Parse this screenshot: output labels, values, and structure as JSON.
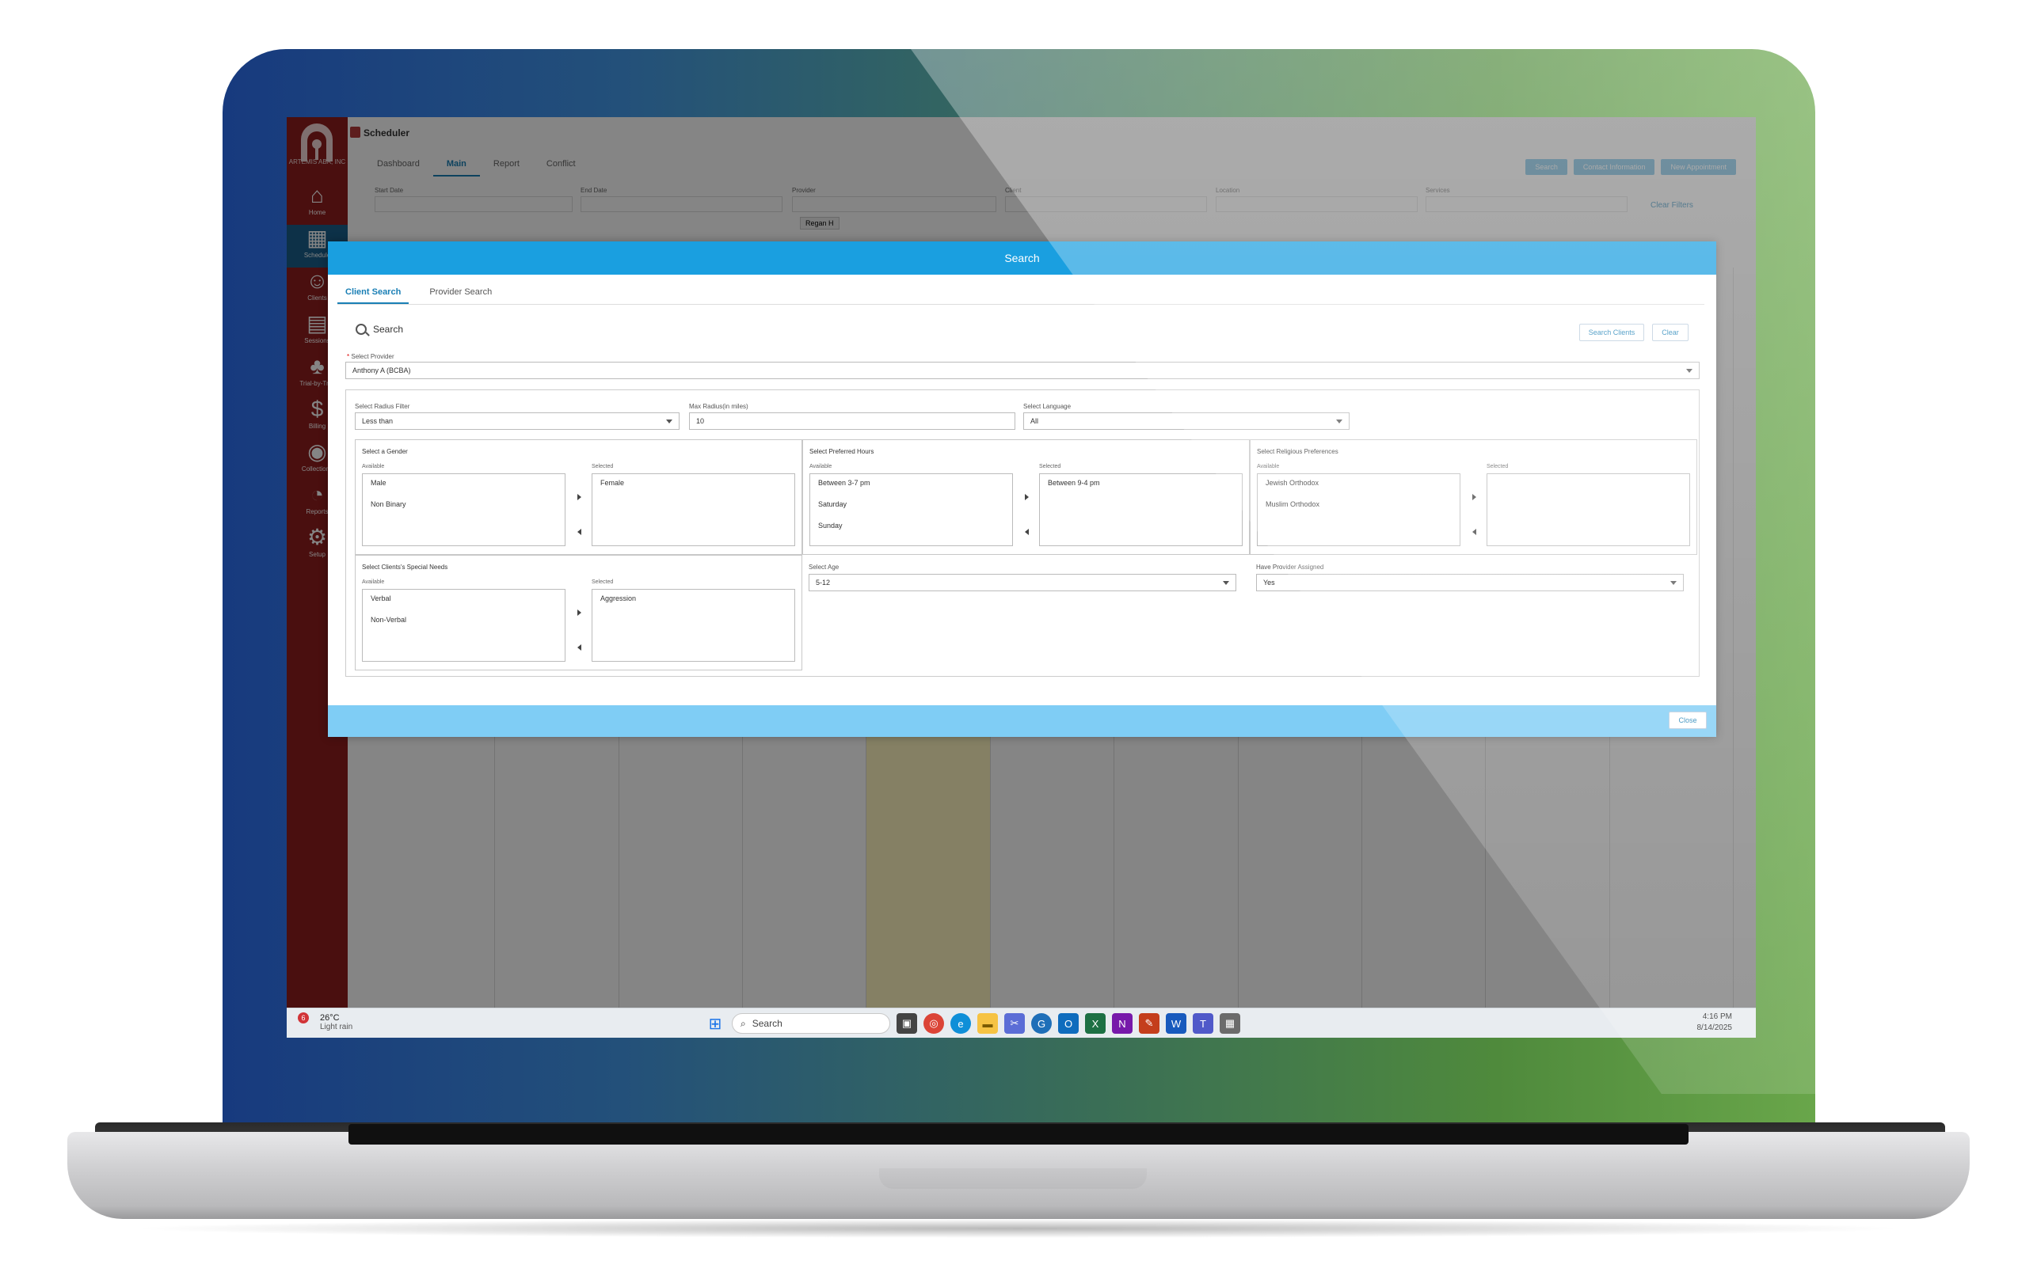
{
  "app": {
    "org": "ARTEMIS ABA, INC",
    "page_title": "Scheduler",
    "sidebar": [
      {
        "label": "Home",
        "icon": "home-icon"
      },
      {
        "label": "Schedule",
        "icon": "calendar-icon"
      },
      {
        "label": "Clients",
        "icon": "users-icon"
      },
      {
        "label": "Sessions",
        "icon": "document-icon"
      },
      {
        "label": "Trial-by-Trial",
        "icon": "footprints-icon"
      },
      {
        "label": "Billing",
        "icon": "dollar-icon"
      },
      {
        "label": "Collections",
        "icon": "coin-icon"
      },
      {
        "label": "Reports",
        "icon": "piechart-icon"
      },
      {
        "label": "Setup",
        "icon": "gear-icon"
      }
    ],
    "tabs": [
      "Dashboard",
      "Main",
      "Report",
      "Conflict"
    ],
    "top_buttons": [
      "Search",
      "Contact Information",
      "New Appointment"
    ],
    "filters": {
      "start_date": "Start Date",
      "end_date": "End Date",
      "provider": "Provider",
      "client": "Client",
      "location": "Location",
      "services": "Services",
      "provider_tag": "Regan H",
      "clear_filters": "Clear Filters"
    }
  },
  "modal": {
    "title": "Search",
    "tabs": [
      "Client Search",
      "Provider Search"
    ],
    "search_heading": "Search",
    "search_clients_btn": "Search Clients",
    "clear_btn": "Clear",
    "select_provider_label": "Select Provider",
    "select_provider_value": "Anthony A (BCBA)",
    "radius_filter_label": "Select Radius Filter",
    "radius_filter_value": "Less than",
    "max_radius_label": "Max Radius(in miles)",
    "max_radius_value": "10",
    "language_label": "Select Language",
    "language_value": "All",
    "available_label": "Available",
    "selected_label": "Selected",
    "gender": {
      "title": "Select a Gender",
      "available": [
        "Male",
        "Non Binary"
      ],
      "selected": [
        "Female"
      ]
    },
    "hours": {
      "title": "Select Preferred Hours",
      "available": [
        "Between 3-7 pm",
        "Saturday",
        "Sunday"
      ],
      "selected": [
        "Between 9-4 pm"
      ]
    },
    "religion": {
      "title": "Select Religious Preferences",
      "available": [
        "Jewish Orthodox",
        "Muslim Orthodox"
      ],
      "selected": []
    },
    "needs": {
      "title": "Select Clients's Special Needs",
      "available": [
        "Verbal",
        "Non-Verbal"
      ],
      "selected": [
        "Aggression"
      ]
    },
    "age_label": "Select Age",
    "age_value": "5-12",
    "have_provider_label": "Have Provider Assigned",
    "have_provider_value": "Yes",
    "close_btn": "Close"
  },
  "taskbar": {
    "weather_badge": "6",
    "temp": "26°C",
    "condition": "Light rain",
    "search": "Search",
    "time": "4:16 PM",
    "date": "8/14/2025"
  }
}
